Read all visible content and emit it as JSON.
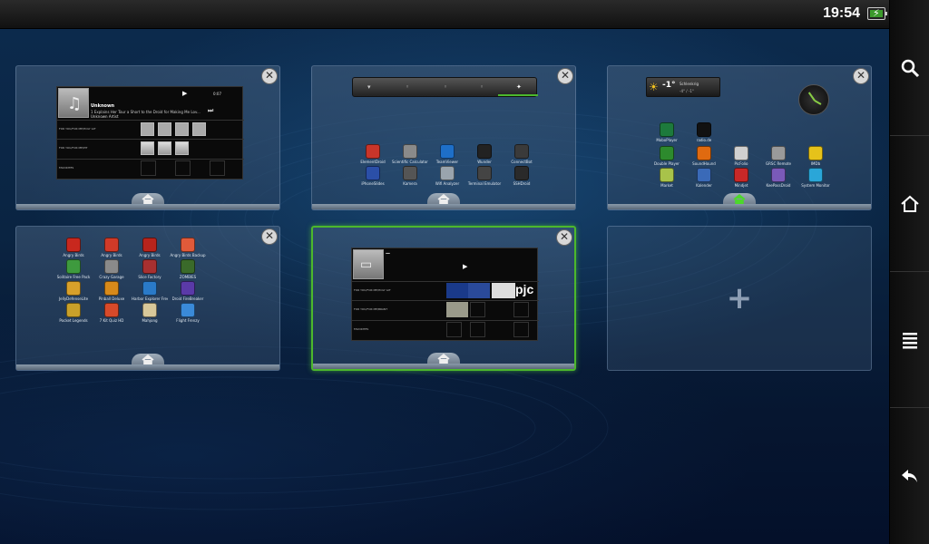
{
  "status_bar": {
    "time": "19:54",
    "battery_icon": "battery-charging-icon"
  },
  "sidebar": {
    "buttons": [
      {
        "icon": "search-icon"
      },
      {
        "icon": "home-icon"
      },
      {
        "icon": "menu-icon"
      },
      {
        "icon": "back-icon"
      }
    ]
  },
  "screen1": {
    "music": {
      "title": "Unknown",
      "description": "1 Explains Her Tour a Short to the Droid for Making Me Lov...",
      "artist": "Unknown Artist",
      "time": "0:07",
      "rows": [
        "FOR YOU/FOR ME/HOLY GIT",
        "FOR YOU/FOR ME/PIT",
        "FAVORITES"
      ]
    }
  },
  "screen2": {
    "apps": [
      {
        "label": "ElementDroid",
        "color": "#c9352a"
      },
      {
        "label": "Scientific Calculator II",
        "color": "#8a8a8a"
      },
      {
        "label": "TeamViewer",
        "color": "#1e6fc8"
      },
      {
        "label": "Wunder",
        "color": "#222222"
      },
      {
        "label": "ConnectBot",
        "color": "#3a3a3a"
      },
      {
        "label": "iPhoneSlides",
        "color": "#2b4fa8"
      },
      {
        "label": "Kamera",
        "color": "#555555"
      },
      {
        "label": "Wifi Analyzer",
        "color": "#9aa4ad"
      },
      {
        "label": "Terminal Emulator",
        "color": "#444444"
      },
      {
        "label": "SSHDroid",
        "color": "#2a2a2a"
      }
    ]
  },
  "screen3": {
    "weather": {
      "temp": "-1°",
      "city": "Schlenkrig",
      "detail": "-4° / -1°"
    },
    "apps": [
      {
        "label": "MoboPlayer",
        "color": "#1d7a3c"
      },
      {
        "label": "radio.de",
        "color": "#111111"
      },
      {
        "label": "Double Player",
        "color": "#2d8a2d"
      },
      {
        "label": "SoundHound",
        "color": "#e06a10"
      },
      {
        "label": "PicFolio",
        "color": "#d0d0d0"
      },
      {
        "label": "GRSC Remote",
        "color": "#9a9a9a"
      },
      {
        "label": "IMDb",
        "color": "#e6c21a"
      },
      {
        "label": "Market",
        "color": "#a8c34a"
      },
      {
        "label": "Kalender",
        "color": "#3a6ab8"
      },
      {
        "label": "Mindjet",
        "color": "#c82828"
      },
      {
        "label": "KeePassDroid",
        "color": "#7a5ab8"
      },
      {
        "label": "System Monitor",
        "color": "#2aa6d8"
      }
    ]
  },
  "screen4": {
    "apps": [
      {
        "label": "Angry Birds",
        "color": "#c8281e"
      },
      {
        "label": "Angry Birds",
        "color": "#d03a28"
      },
      {
        "label": "Angry Birds",
        "color": "#b8241c"
      },
      {
        "label": "Angry Birds Backup",
        "color": "#e05a3a"
      },
      {
        "label": "Solitaire Free Pack",
        "color": "#3e9a3e"
      },
      {
        "label": "Crazy Garage",
        "color": "#8a8a8a"
      },
      {
        "label": "Slice Factory",
        "color": "#a83030"
      },
      {
        "label": "ZOMBIES",
        "color": "#3a6a2a"
      },
      {
        "label": "JellyDefenseLite",
        "color": "#d8a02a"
      },
      {
        "label": "Pinball Deluxe",
        "color": "#d88a1a"
      },
      {
        "label": "Harbor Explorer Free",
        "color": "#2a7ac8"
      },
      {
        "label": "Droid FireBreaker",
        "color": "#5a3aa8"
      },
      {
        "label": "Pocket Legends",
        "color": "#c8a02a"
      },
      {
        "label": "7 Kit Quiz HD",
        "color": "#d84a2a"
      },
      {
        "label": "Mahjong",
        "color": "#d8c89a"
      },
      {
        "label": "Flight Frenzy",
        "color": "#3a8ad8"
      }
    ]
  },
  "screen5": {
    "music": {
      "title": "—",
      "rows": [
        "FOR YOU/FOR ME/HOLY GIT",
        "FOR YOU/FOR ME/BRANT",
        "FAVORITES"
      ],
      "thumb_text": "pjc"
    }
  }
}
